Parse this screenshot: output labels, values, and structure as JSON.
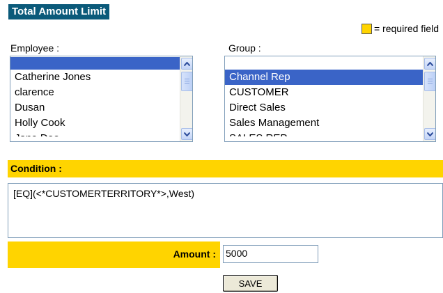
{
  "page": {
    "title": "Total Amount Limit"
  },
  "legend": {
    "text": "= required field",
    "color": "#ffd400"
  },
  "employee": {
    "label": "Employee :",
    "items": [
      "",
      "Catherine Jones",
      "clarence",
      "Dusan",
      "Holly Cook",
      "Jane Doe"
    ],
    "selected_index": 0
  },
  "group": {
    "label": "Group :",
    "items": [
      "",
      "Channel Rep",
      "CUSTOMER",
      "Direct Sales",
      "Sales Management",
      "SALES REP"
    ],
    "selected_index": 1
  },
  "condition": {
    "label": "Condition :",
    "value": "[EQ](<*CUSTOMERTERRITORY*>,West)"
  },
  "amount": {
    "label": "Amount :",
    "value": "5000"
  },
  "save": {
    "label": "SAVE"
  },
  "colors": {
    "title_bg": "#0b5a7a",
    "required": "#ffd400",
    "selection": "#3a64c7"
  }
}
